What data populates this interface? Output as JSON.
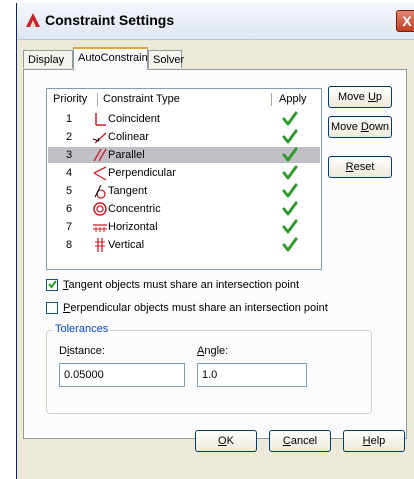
{
  "window": {
    "title": "Constraint Settings",
    "close_label": "X"
  },
  "tabs": [
    {
      "label": "Display",
      "active": false
    },
    {
      "label": "AutoConstrain",
      "active": true
    },
    {
      "label": "Solver",
      "active": false
    }
  ],
  "list": {
    "headers": {
      "priority": "Priority",
      "type": "Constraint Type",
      "apply": "Apply"
    },
    "rows": [
      {
        "priority": "1",
        "label": "Coincident",
        "icon": "coincident-icon",
        "apply": true,
        "selected": false
      },
      {
        "priority": "2",
        "label": "Colinear",
        "icon": "colinear-icon",
        "apply": true,
        "selected": false
      },
      {
        "priority": "3",
        "label": "Parallel",
        "icon": "parallel-icon",
        "apply": true,
        "selected": true
      },
      {
        "priority": "4",
        "label": "Perpendicular",
        "icon": "perpendicular-icon",
        "apply": true,
        "selected": false
      },
      {
        "priority": "5",
        "label": "Tangent",
        "icon": "tangent-icon",
        "apply": true,
        "selected": false
      },
      {
        "priority": "6",
        "label": "Concentric",
        "icon": "concentric-icon",
        "apply": true,
        "selected": false
      },
      {
        "priority": "7",
        "label": "Horizontal",
        "icon": "horizontal-icon",
        "apply": true,
        "selected": false
      },
      {
        "priority": "8",
        "label": "Vertical",
        "icon": "vertical-icon",
        "apply": true,
        "selected": false
      }
    ]
  },
  "side_buttons": {
    "move_up": {
      "pre": "Move ",
      "accel": "U",
      "post": "p"
    },
    "move_down": {
      "pre": "Move ",
      "accel": "D",
      "post": "own"
    },
    "reset": {
      "pre": "",
      "accel": "R",
      "post": "eset"
    }
  },
  "options": {
    "tangent": {
      "accel": "T",
      "rest": "angent objects must share an intersection point",
      "checked": true
    },
    "perpendicular": {
      "accel": "P",
      "rest": "erpendicular objects must share an intersection point",
      "checked": false
    }
  },
  "tolerances": {
    "title": "Tolerances",
    "distance_label": {
      "pre": "D",
      "accel": "i",
      "post": "stance:"
    },
    "distance_value": "0.05000",
    "angle_label": {
      "pre": "",
      "accel": "A",
      "post": "ngle:"
    },
    "angle_value": "1.0"
  },
  "footer": {
    "ok": {
      "accel": "O",
      "post": "K"
    },
    "cancel": {
      "accel": "C",
      "post": "ancel"
    },
    "help": {
      "accel": "H",
      "post": "elp"
    }
  },
  "colors": {
    "check": "#2f9a2f",
    "icon_red": "#c8202a",
    "selected_row": "#c0bfc6"
  }
}
